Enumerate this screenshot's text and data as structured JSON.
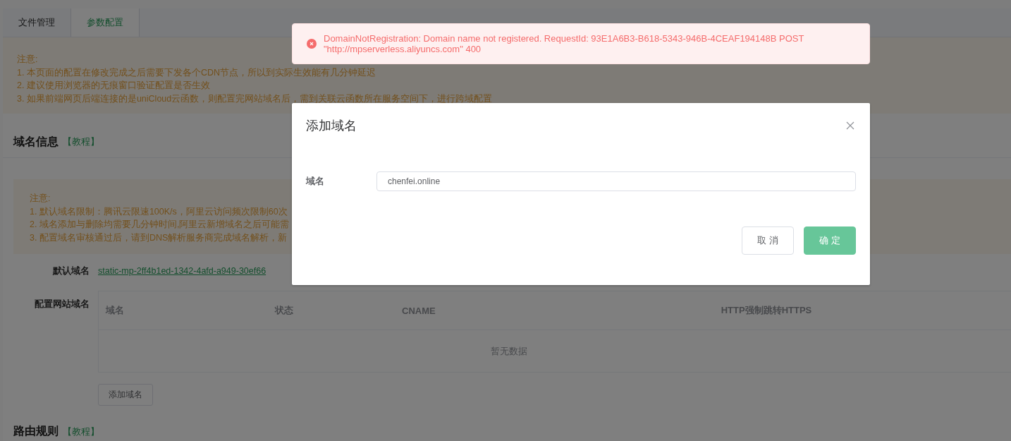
{
  "tabs": [
    {
      "label": "文件管理",
      "selected": false
    },
    {
      "label": "参数配置",
      "selected": true
    }
  ],
  "notice": {
    "title": "注意:",
    "lines": [
      "1. 本页面的配置在修改完成之后需要下发各个CDN节点，所以到实际生效能有几分钟延迟",
      "2. 建议使用浏览器的无痕窗口验证配置是否生效",
      "3. 如果前端网页后端连接的是uniCloud云函数，则配置完网站域名后，需到关联云函数所在服务空间下，进行跨域配置"
    ]
  },
  "domain_section": {
    "title": "域名信息",
    "link": "【教程】",
    "notice": {
      "title": "注意:",
      "lines": [
        "1. 默认域名限制：腾讯云限速100K/s，阿里云访问频次限制60次",
        "2. 域名添加与删除均需要几分钟时间,阿里云新增域名之后可能需",
        "3. 配置域名审核通过后，请到DNS解析服务商完成域名解析，新"
      ]
    },
    "default_domain": {
      "label": "默认域名",
      "value": "static-mp-2ff4b1ed-1342-4afd-a949-30ef66"
    },
    "site_domains": {
      "label": "配置网站域名",
      "columns": [
        "域名",
        "状态",
        "CNAME",
        "HTTP强制跳转HTTPS"
      ],
      "empty_text": "暂无数据"
    },
    "add_button": "添加域名"
  },
  "route_section": {
    "title": "路由规则",
    "link": "【教程】"
  },
  "toast": {
    "kind": "error",
    "message": "DomainNotRegistration: Domain name not registered. RequestId: 93E1A6B3-B618-5343-946B-4CEAF194148B POST \"http://mpserverless.aliyuncs.com\" 400"
  },
  "dialog": {
    "title": "添加域名",
    "field_label": "域名",
    "field_value": "chenfei.online",
    "buttons": [
      {
        "label": "取 消",
        "kind": "default"
      },
      {
        "label": "确 定",
        "kind": "primary"
      }
    ]
  }
}
